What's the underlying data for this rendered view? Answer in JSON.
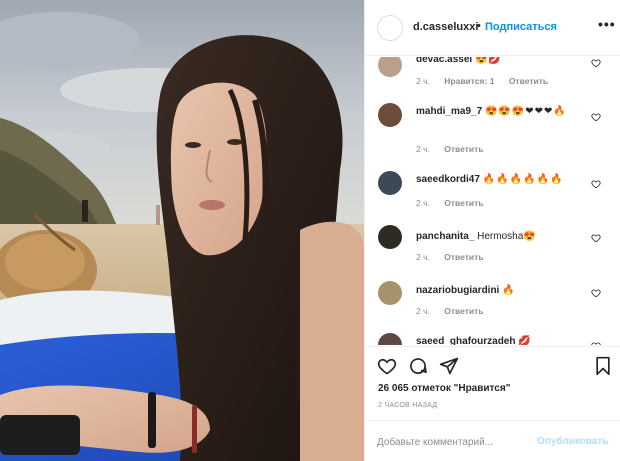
{
  "post": {
    "username": "d.casseluxxi",
    "separator": "•",
    "follow_label": "Подписаться",
    "more_label": "•••"
  },
  "comments": [
    {
      "user": "devac.assel",
      "text": "",
      "emoji": "😍💋",
      "time": "2 ч.",
      "likes": "Нравится: 1",
      "reply": "Ответить",
      "avatar_color": "#b9a08a"
    },
    {
      "user": "mahdi_ma9_7",
      "text": "",
      "emoji": "😍😍😍❤❤❤🔥",
      "time": "2 ч.",
      "likes": "",
      "reply": "Ответить",
      "avatar_color": "#6d4c3a"
    },
    {
      "user": "saeedkordi47",
      "text": "",
      "emoji": "🔥🔥🔥🔥🔥🔥",
      "time": "2 ч.",
      "likes": "",
      "reply": "Ответить",
      "avatar_color": "#3c4a55"
    },
    {
      "user": "panchanita_",
      "text": "Hermosha",
      "emoji": "😍",
      "time": "2 ч.",
      "likes": "",
      "reply": "Ответить",
      "avatar_color": "#2e2a24"
    },
    {
      "user": "nazariobugiardini",
      "text": "",
      "emoji": "🔥",
      "time": "2 ч.",
      "likes": "",
      "reply": "Ответить",
      "avatar_color": "#a8926a"
    },
    {
      "user": "saeed_ghafourzadeh",
      "text": "",
      "emoji": "💋",
      "time": "",
      "likes": "",
      "reply": "",
      "avatar_color": "#5a4a40"
    }
  ],
  "footer": {
    "likes_count": "26 065 отметок \"Нравится\"",
    "time_ago": "2 ЧАСОВ НАЗАД",
    "comment_placeholder": "Добавьте комментарий...",
    "publish_label": "Опубликовать"
  },
  "colors": {
    "accent": "#0095f6",
    "publish_disabled": "#b2dffc",
    "muted": "#8e8e8e",
    "text": "#262626",
    "border": "#efefef"
  },
  "icons": {
    "like": "heart-icon",
    "comment": "comment-bubble-icon",
    "share": "paper-plane-icon",
    "save": "bookmark-icon",
    "comment_like": "small-heart-icon"
  }
}
